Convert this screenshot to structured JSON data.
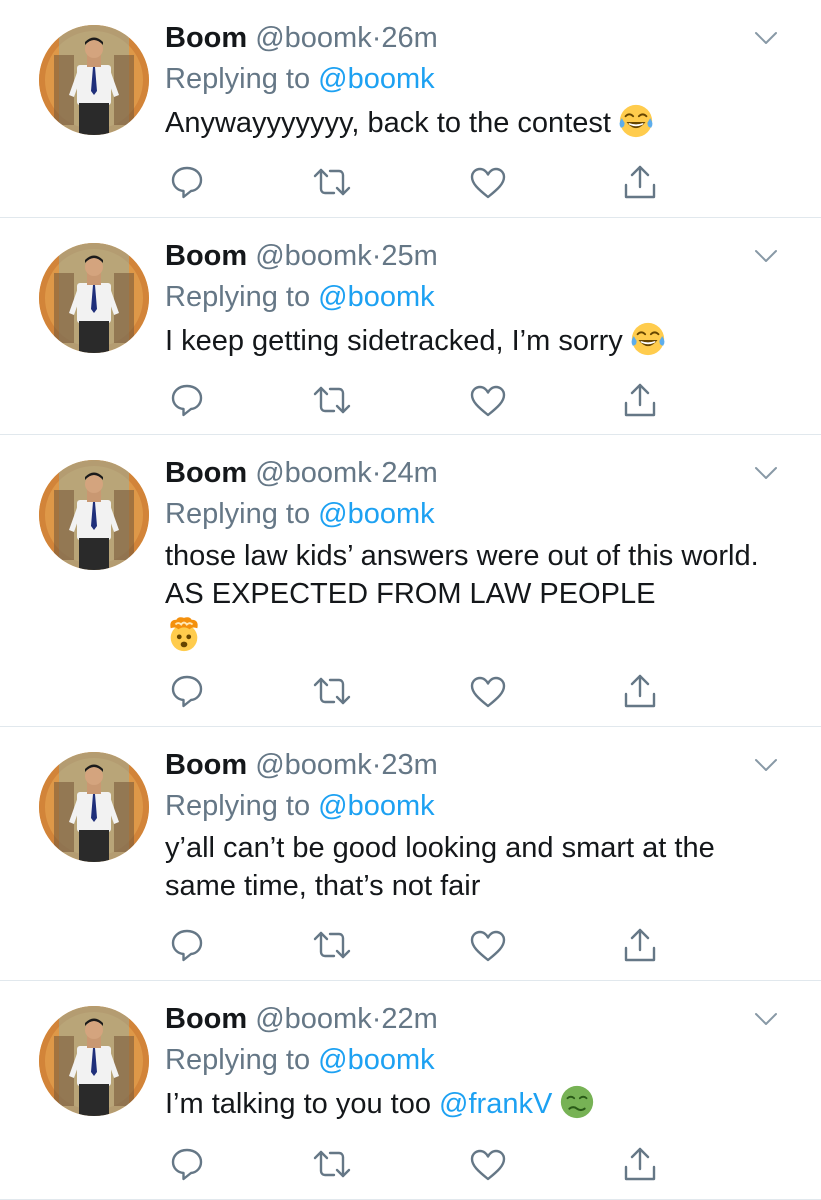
{
  "tweets": [
    {
      "name": "Boom",
      "handle": "@boomk",
      "separator": "·",
      "time": "26m",
      "reply_prefix": "Replying to",
      "reply_to": "@boomk",
      "text": "Anywayyyyyyy, back to the contest",
      "mention": "",
      "emoji": "face-with-tears-of-joy"
    },
    {
      "name": "Boom",
      "handle": "@boomk",
      "separator": "·",
      "time": "25m",
      "reply_prefix": "Replying to",
      "reply_to": "@boomk",
      "text": "I keep getting sidetracked, I’m sorry",
      "mention": "",
      "emoji": "face-with-tears-of-joy"
    },
    {
      "name": "Boom",
      "handle": "@boomk",
      "separator": "·",
      "time": "24m",
      "reply_prefix": "Replying to",
      "reply_to": "@boomk",
      "text": "those law kids’ answers were out of this world. AS EXPECTED FROM LAW PEOPLE",
      "mention": "",
      "emoji": "exploding-head"
    },
    {
      "name": "Boom",
      "handle": "@boomk",
      "separator": "·",
      "time": "23m",
      "reply_prefix": "Replying to",
      "reply_to": "@boomk",
      "text": "y’all can’t be good looking and smart at the same time, that’s not fair",
      "mention": "",
      "emoji": ""
    },
    {
      "name": "Boom",
      "handle": "@boomk",
      "separator": "·",
      "time": "22m",
      "reply_prefix": "Replying to",
      "reply_to": "@boomk",
      "text": "I’m talking to you too",
      "mention": "@frankV",
      "emoji": "nauseated-face"
    }
  ],
  "icons": {
    "reply": "reply-icon",
    "retweet": "retweet-icon",
    "like": "heart-icon",
    "share": "share-icon",
    "more": "chevron-down-icon"
  },
  "colors": {
    "text": "#14171a",
    "secondary": "#657786",
    "link": "#1da1f2",
    "divider": "#e1e8ed"
  }
}
